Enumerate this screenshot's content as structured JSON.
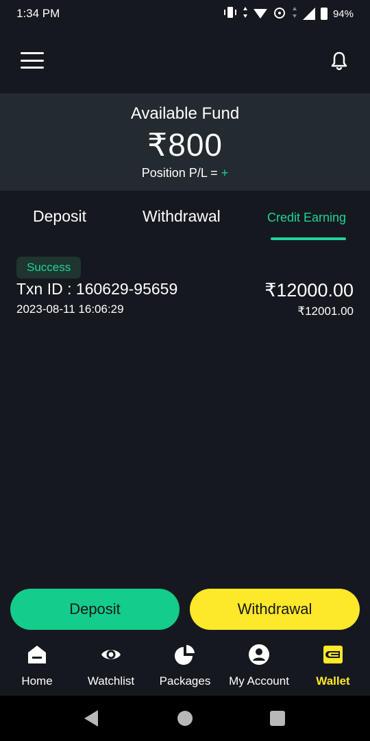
{
  "status_bar": {
    "time": "1:34 PM",
    "battery": "94%"
  },
  "fund": {
    "title": "Available Fund",
    "amount": "₹800",
    "position_label": "Position P/L = ",
    "position_value": "+"
  },
  "tabs": {
    "deposit": "Deposit",
    "withdrawal": "Withdrawal",
    "credit": "Credit Earning"
  },
  "transaction": {
    "status": "Success",
    "id": "Txn ID : 160629-95659",
    "date": "2023-08-11 16:06:29",
    "amount": "₹12000.00",
    "sub_amount": "₹12001.00"
  },
  "actions": {
    "deposit": "Deposit",
    "withdrawal": "Withdrawal"
  },
  "nav": {
    "home": "Home",
    "watchlist": "Watchlist",
    "packages": "Packages",
    "account": "My Account",
    "wallet": "Wallet"
  },
  "colors": {
    "accent_green": "#20d49a",
    "accent_yellow": "#fde829",
    "background": "#161820"
  }
}
